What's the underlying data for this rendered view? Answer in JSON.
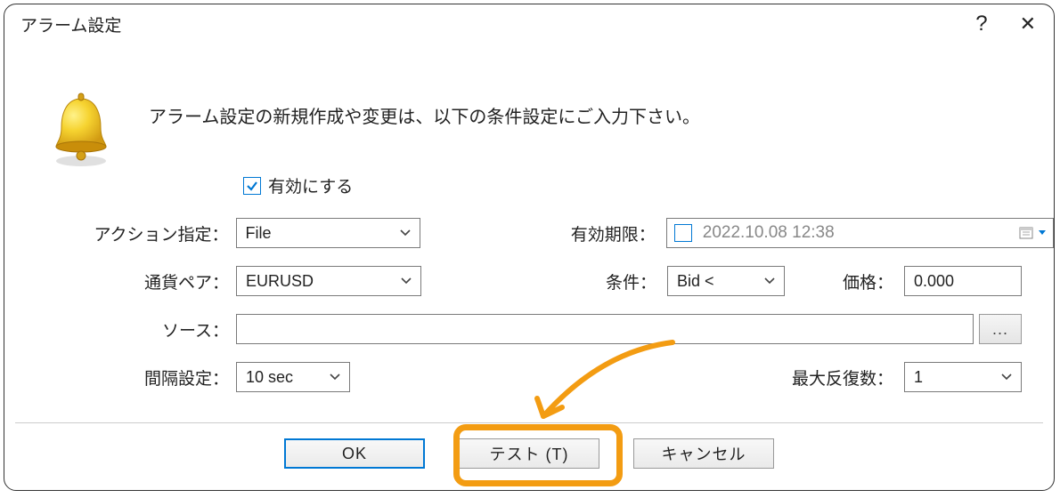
{
  "titlebar": {
    "title": "アラーム設定"
  },
  "intro": "アラーム設定の新規作成や変更は、以下の条件設定にご入力下さい。",
  "form": {
    "enable_label": "有効にする",
    "enable_checked": true,
    "action": {
      "label": "アクション指定：",
      "value": "File"
    },
    "expiry": {
      "label": "有効期限：",
      "value": "2022.10.08 12:38",
      "checked": false
    },
    "symbol": {
      "label": "通貨ペア：",
      "value": "EURUSD"
    },
    "condition": {
      "label": "条件：",
      "value": "Bid <"
    },
    "price": {
      "label": "価格：",
      "value": "0.000"
    },
    "source": {
      "label": "ソース：",
      "value": ""
    },
    "browse": "...",
    "interval": {
      "label": "間隔設定：",
      "value": "10 sec"
    },
    "maxrep": {
      "label": "最大反復数：",
      "value": "1"
    }
  },
  "buttons": {
    "ok": "OK",
    "test": "テスト (T)",
    "cancel": "キャンセル"
  }
}
